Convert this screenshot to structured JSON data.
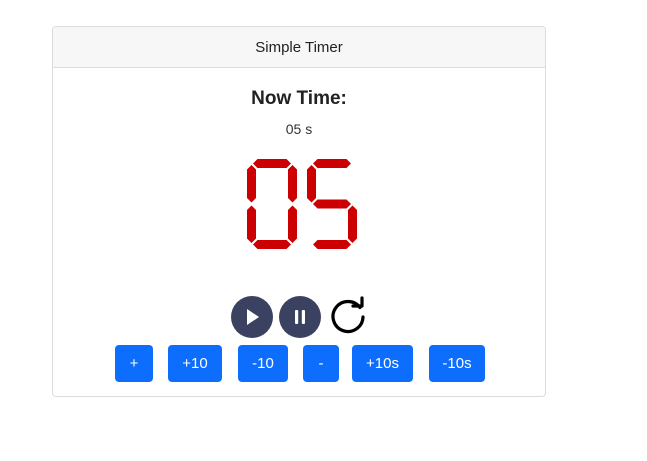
{
  "card": {
    "title": "Simple Timer"
  },
  "timer": {
    "label": "Now Time:",
    "value_text": "05 s",
    "display_digits": "05",
    "digit_color": "#cc0000"
  },
  "controls": {
    "play_icon": "play-icon",
    "pause_icon": "pause-icon",
    "reload_icon": "reload-icon"
  },
  "buttons": [
    {
      "label": "+"
    },
    {
      "label": "+10"
    },
    {
      "label": "-10"
    },
    {
      "label": "-"
    },
    {
      "label": "+10s"
    },
    {
      "label": "-10s"
    }
  ],
  "colors": {
    "button_primary": "#0d6efd",
    "control_dark": "#3b4160"
  }
}
